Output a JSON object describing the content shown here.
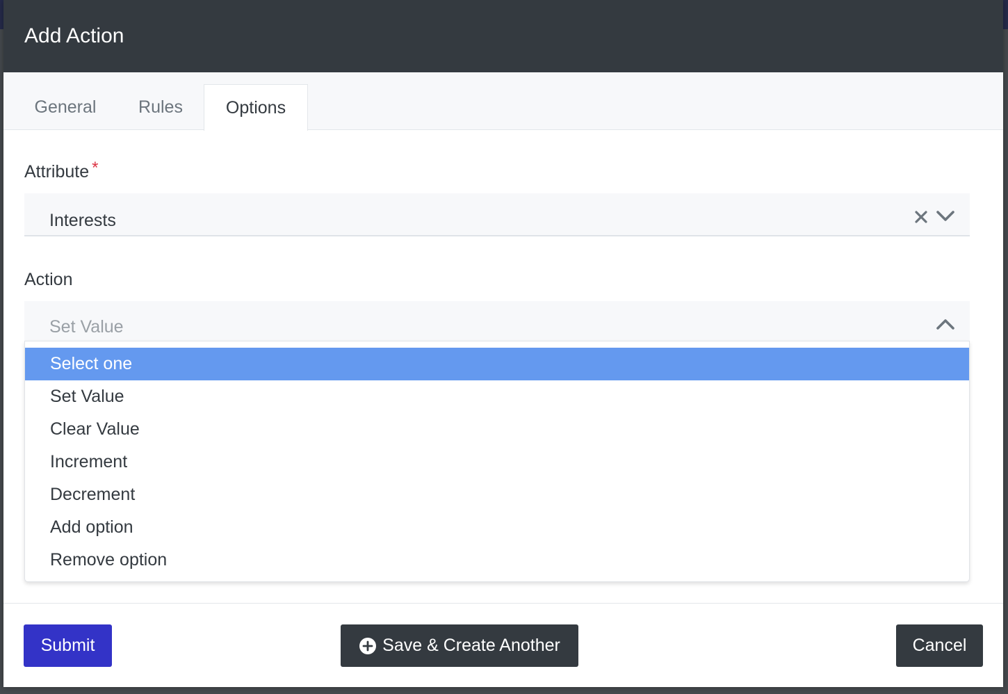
{
  "modal": {
    "title": "Add Action"
  },
  "tabs": [
    {
      "label": "General",
      "active": false
    },
    {
      "label": "Rules",
      "active": false
    },
    {
      "label": "Options",
      "active": true
    }
  ],
  "attribute_field": {
    "label": "Attribute",
    "required_marker": "*",
    "value": "Interests",
    "clear_icon": "close-icon",
    "toggle_icon": "chevron-down-icon"
  },
  "action_field": {
    "label": "Action",
    "value": "Set Value",
    "toggle_icon": "chevron-up-icon",
    "options": [
      {
        "label": "Select one",
        "highlighted": true
      },
      {
        "label": "Set Value"
      },
      {
        "label": "Clear Value"
      },
      {
        "label": "Increment"
      },
      {
        "label": "Decrement"
      },
      {
        "label": "Add option"
      },
      {
        "label": "Remove option"
      }
    ]
  },
  "footer": {
    "submit_label": "Submit",
    "save_another_label": "Save & Create Another",
    "save_another_icon": "plus-circle-icon",
    "cancel_label": "Cancel"
  },
  "colors": {
    "header_bg": "#343a40",
    "primary": "#3333c7",
    "highlight": "#6499ef",
    "required": "#dc3545"
  }
}
